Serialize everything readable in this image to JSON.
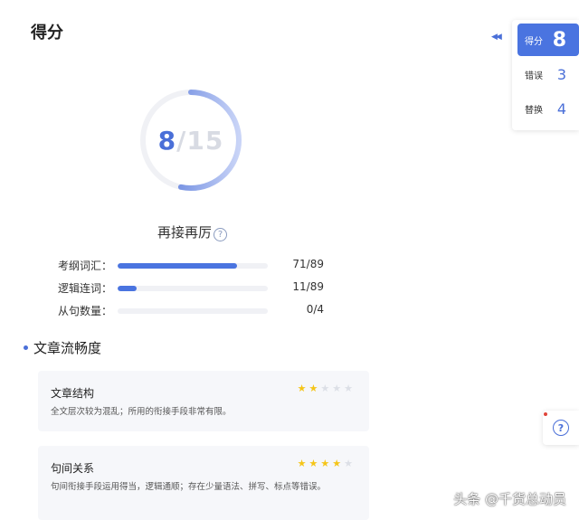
{
  "page_title": "得分",
  "score": {
    "value": "8",
    "separator": "/",
    "total": "15",
    "fraction": 0.533
  },
  "level": {
    "label": "再接再厉",
    "help_glyph": "?"
  },
  "metrics": [
    {
      "label": "考纲词汇：",
      "value": "71/89",
      "fraction": 0.798
    },
    {
      "label": "逻辑连词：",
      "value": "11/89",
      "fraction": 0.124
    },
    {
      "label": "从句数量：",
      "value": "0/4",
      "fraction": 0.0
    }
  ],
  "section": {
    "title": "文章流畅度"
  },
  "evaluations": [
    {
      "title": "文章结构",
      "stars": 2,
      "max_stars": 5,
      "description": "全文层次较为混乱；所用的衔接手段非常有限。"
    },
    {
      "title": "句间关系",
      "stars": 4,
      "max_stars": 5,
      "description": "句间衔接手段运用得当，逻辑通顺；存在少量语法、拼写、标点等错误。"
    }
  ],
  "side_panel": {
    "items": [
      {
        "label": "得分",
        "value": "8",
        "active": true
      },
      {
        "label": "错误",
        "value": "3",
        "active": false
      },
      {
        "label": "替换",
        "value": "4",
        "active": false
      }
    ]
  },
  "float_help": {
    "glyph": "?"
  },
  "collapse": {
    "glyph": "◀◀"
  },
  "watermark": "头条 @千货总动员",
  "colors": {
    "accent": "#4a74e0",
    "ring_start": "#4a6fd8",
    "ring_end": "#c9d4f7",
    "track": "#f0f1f5",
    "star_on": "#f5c518",
    "star_off": "#dcdfe6"
  }
}
